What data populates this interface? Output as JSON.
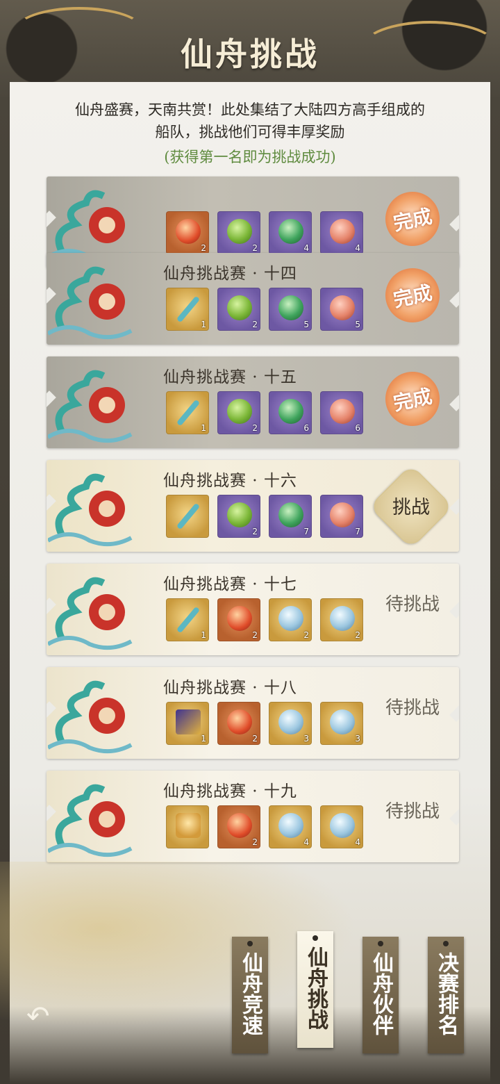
{
  "header": {
    "title": "仙舟挑战"
  },
  "intro": {
    "line1": "仙舟盛赛，天南共赏！此处集结了大陆四方高手组成的",
    "line2": "船队，挑战他们可得丰厚奖励",
    "note": "(获得第一名即为挑战成功)"
  },
  "challenges": [
    {
      "title": "",
      "status": "完成",
      "items": [
        {
          "icon": "peach-icon",
          "count": "2"
        },
        {
          "icon": "green-orb-icon",
          "count": "2"
        },
        {
          "icon": "jade-box-icon",
          "count": "4"
        },
        {
          "icon": "red-box-icon",
          "count": "4"
        }
      ]
    },
    {
      "title": "仙舟挑战赛 · 十四",
      "status": "完成",
      "items": [
        {
          "icon": "sword-icon",
          "count": "1"
        },
        {
          "icon": "green-orb-icon",
          "count": "2"
        },
        {
          "icon": "jade-box-icon",
          "count": "5"
        },
        {
          "icon": "red-box-icon",
          "count": "5"
        }
      ]
    },
    {
      "title": "仙舟挑战赛 · 十五",
      "status": "完成",
      "items": [
        {
          "icon": "sword-icon",
          "count": "1"
        },
        {
          "icon": "green-orb-icon",
          "count": "2"
        },
        {
          "icon": "jade-box-icon",
          "count": "6"
        },
        {
          "icon": "red-box-icon",
          "count": "6"
        }
      ]
    },
    {
      "title": "仙舟挑战赛 · 十六",
      "status": "挑战",
      "items": [
        {
          "icon": "sword-icon",
          "count": ""
        },
        {
          "icon": "green-orb-icon",
          "count": "2"
        },
        {
          "icon": "jade-box-icon",
          "count": "7"
        },
        {
          "icon": "red-box-icon",
          "count": "7"
        }
      ]
    },
    {
      "title": "仙舟挑战赛 · 十七",
      "status": "待挑战",
      "items": [
        {
          "icon": "sword-icon",
          "count": "1"
        },
        {
          "icon": "peach-icon",
          "count": "2"
        },
        {
          "icon": "green-jar-icon",
          "count": "2"
        },
        {
          "icon": "red-jar-icon",
          "count": "2"
        }
      ]
    },
    {
      "title": "仙舟挑战赛 · 十八",
      "status": "待挑战",
      "items": [
        {
          "icon": "book-icon",
          "count": "1"
        },
        {
          "icon": "peach-icon",
          "count": "2"
        },
        {
          "icon": "green-jar-icon",
          "count": "3"
        },
        {
          "icon": "red-jar-icon",
          "count": "3"
        }
      ]
    },
    {
      "title": "仙舟挑战赛 · 十九",
      "status": "待挑战",
      "items": [
        {
          "icon": "robe-icon",
          "count": ""
        },
        {
          "icon": "peach-icon",
          "count": "2"
        },
        {
          "icon": "green-jar-icon",
          "count": "4"
        },
        {
          "icon": "red-jar-icon",
          "count": "4"
        }
      ]
    }
  ],
  "tabs": [
    {
      "label": "仙舟竞速",
      "selected": false
    },
    {
      "label": "仙舟挑战",
      "selected": true
    },
    {
      "label": "仙舟伙伴",
      "selected": false
    },
    {
      "label": "决赛排名",
      "selected": false
    }
  ],
  "back_icon": "back-arrow-icon",
  "colors": {
    "note_green": "#5f8b3f",
    "stamp_orange": "#e0743a",
    "title_cream": "#f6edd6"
  }
}
